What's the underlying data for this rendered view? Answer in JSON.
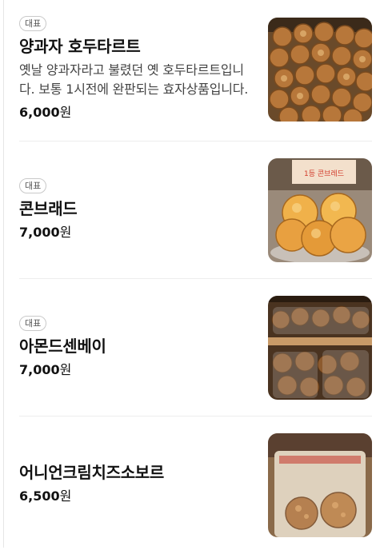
{
  "menu": [
    {
      "badge": "대표",
      "name": "양과자 호두타르트",
      "description": "옛날 양과자라고 불렸던 옛 호두타르트입니다. 보통 1시전에 완판되는 효자상품입니다.",
      "price": "6,000",
      "currency": "원"
    },
    {
      "badge": "대표",
      "name": "콘브래드",
      "price": "7,000",
      "currency": "원",
      "photo_sign": "1등 콘브레드"
    },
    {
      "badge": "대표",
      "name": "아몬드센베이",
      "price": "7,000",
      "currency": "원"
    },
    {
      "name": "어니언크림치즈소보르",
      "price": "6,500",
      "currency": "원"
    }
  ]
}
